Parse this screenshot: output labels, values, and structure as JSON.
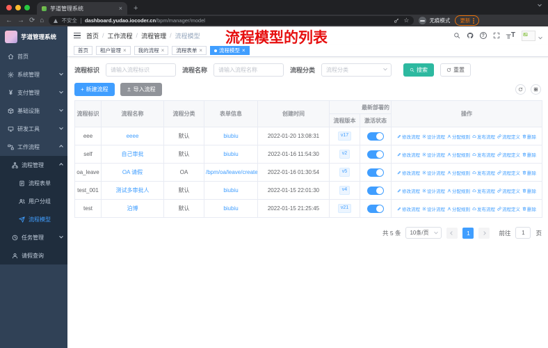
{
  "browser": {
    "tab_title": "芋道管理系统",
    "security_label": "不安全",
    "url_domain": "dashboard.yudao.iocoder.cn",
    "url_path": "/bpm/manager/model",
    "incognito_label": "无痕模式",
    "update_label": "更新"
  },
  "sidebar": {
    "logo_title": "芋道管理系统",
    "items": [
      {
        "label": "首页"
      },
      {
        "label": "系统管理"
      },
      {
        "label": "支付管理"
      },
      {
        "label": "基础设施"
      },
      {
        "label": "研发工具"
      },
      {
        "label": "工作流程"
      },
      {
        "label": "流程管理"
      },
      {
        "label": "流程表单"
      },
      {
        "label": "用户分组"
      },
      {
        "label": "流程模型"
      },
      {
        "label": "任务管理"
      },
      {
        "label": "请假查询"
      }
    ]
  },
  "navbar": {
    "breadcrumb": [
      "首页",
      "工作流程",
      "流程管理",
      "流程模型"
    ],
    "annotation": "流程模型的列表"
  },
  "tags": {
    "items": [
      {
        "label": "首页"
      },
      {
        "label": "租户管理"
      },
      {
        "label": "我的流程"
      },
      {
        "label": "流程表单"
      },
      {
        "label": "流程模型"
      }
    ]
  },
  "search": {
    "id_label": "流程标识",
    "id_placeholder": "请输入流程标识",
    "name_label": "流程名称",
    "name_placeholder": "请输入流程名称",
    "cat_label": "流程分类",
    "cat_placeholder": "流程分类",
    "search_label": "搜索",
    "reset_label": "重置"
  },
  "toolbar": {
    "create_label": "新建流程",
    "import_label": "导入流程"
  },
  "table": {
    "headers": {
      "key": "流程标识",
      "name": "流程名称",
      "category": "流程分类",
      "form": "表单信息",
      "created": "创建时间",
      "deploy_group": "最新部署的",
      "version": "流程版本",
      "state": "激活状态",
      "ops": "操作"
    },
    "actions": [
      "修改流程",
      "设计流程",
      "分配规则",
      "发布流程",
      "流程定义",
      "删除"
    ],
    "rows": [
      {
        "key": "eee",
        "name": "eeee",
        "category": "默认",
        "form": "biubiu",
        "created": "2022-01-20 13:08:31",
        "version": "v17"
      },
      {
        "key": "self",
        "name": "自己审批",
        "category": "默认",
        "form": "biubiu",
        "created": "2022-01-16 11:54:30",
        "version": "v2"
      },
      {
        "key": "oa_leave",
        "name": "OA 请假",
        "category": "OA",
        "form": "/bpm/oa/leave/create",
        "created": "2022-01-16 01:30:54",
        "version": "v5"
      },
      {
        "key": "test_001",
        "name": "测试多审批人",
        "category": "默认",
        "form": "biubiu",
        "created": "2022-01-15 22:01:30",
        "version": "v4"
      },
      {
        "key": "test",
        "name": "泊博",
        "category": "默认",
        "form": "biubiu",
        "created": "2022-01-15 21:25:45",
        "version": "v21"
      }
    ]
  },
  "pagination": {
    "total": "共 5 条",
    "size": "10条/页",
    "page": "1",
    "goto_label": "前往",
    "goto_value": "1",
    "unit": "页"
  },
  "colors": {
    "accent": "#409eff",
    "search_button": "#2db9a0",
    "sidebar_bg": "#304156",
    "submenu_bg": "#1f2d3d",
    "annotation_red": "#e60f0f"
  }
}
